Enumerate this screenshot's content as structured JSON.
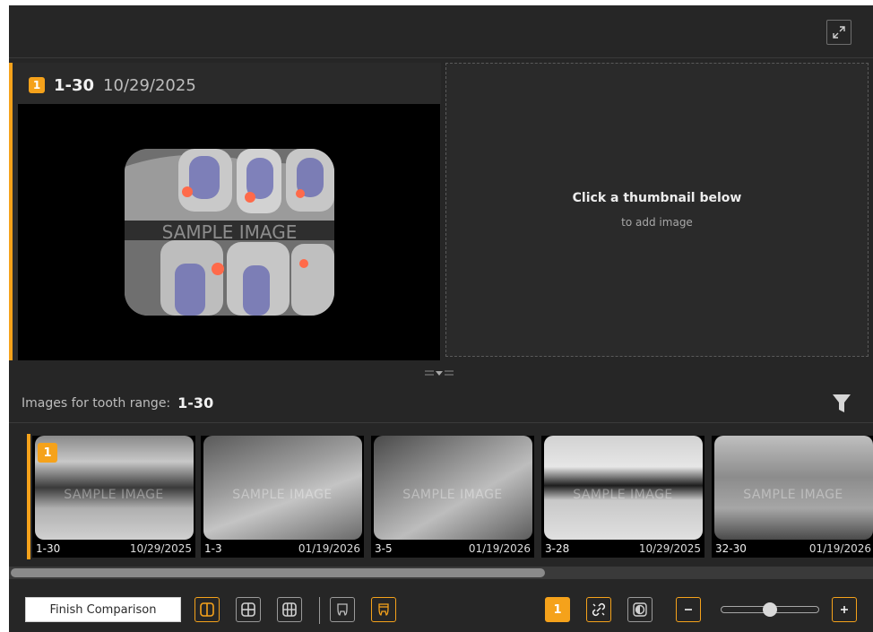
{
  "viewer": {
    "pane_left": {
      "badge": "1",
      "range": "1-30",
      "date": "10/29/2025",
      "watermark": "SAMPLE IMAGE"
    },
    "pane_right": {
      "title": "Click a thumbnail below",
      "subtitle": "to add image"
    }
  },
  "range_bar": {
    "label": "Images for tooth range:",
    "value": "1-30"
  },
  "thumbnails": [
    {
      "badge": "1",
      "range": "1-30",
      "date": "10/29/2025",
      "watermark": "SAMPLE IMAGE"
    },
    {
      "range": "1-3",
      "date": "01/19/2026",
      "watermark": "SAMPLE IMAGE"
    },
    {
      "range": "3-5",
      "date": "01/19/2026",
      "watermark": "SAMPLE IMAGE"
    },
    {
      "range": "3-28",
      "date": "10/29/2025",
      "watermark": "SAMPLE IMAGE"
    },
    {
      "range": "32-30",
      "date": "01/19/2026",
      "watermark": "SAMPLE IMAGE"
    }
  ],
  "toolbar": {
    "finish_label": "Finish Comparison",
    "count_badge": "1",
    "zoom_level": 0.5
  },
  "icons": {
    "expand": "expand-icon",
    "filter": "filter-icon",
    "layout_1x2": "layout-two-column-icon",
    "layout_2x2": "layout-grid-2x2-icon",
    "layout_3x3": "layout-grid-3x3-icon",
    "tooth_upper": "tooth-icon",
    "tooth_lower": "tooth-lower-icon",
    "link": "unlink-icon",
    "contrast": "contrast-icon",
    "zoom_out": "minus-icon",
    "zoom_in": "plus-icon"
  },
  "colors": {
    "accent": "#f5a21b",
    "background": "#262626"
  }
}
